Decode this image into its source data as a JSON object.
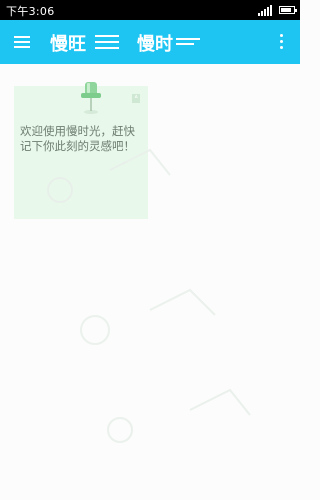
{
  "status_bar": {
    "time": "下午3:06",
    "signal_icon": "signal-bars-icon",
    "battery_icon": "battery-icon",
    "battery_level": 0.8
  },
  "app_bar": {
    "background": "#1ec5f2",
    "menu_icon": "hamburger-menu-icon",
    "title": "慢旺",
    "ghost_title": "慢时",
    "overflow_icon": "more-vertical-icon"
  },
  "note": {
    "background": "#e8f8ea",
    "pin_icon": "pushpin-icon",
    "text": "欢迎使用慢时光，赶快记下你此刻的灵感吧！"
  },
  "colors": {
    "page_background": "#fbfcfb",
    "note_text": "#6d7d70"
  }
}
